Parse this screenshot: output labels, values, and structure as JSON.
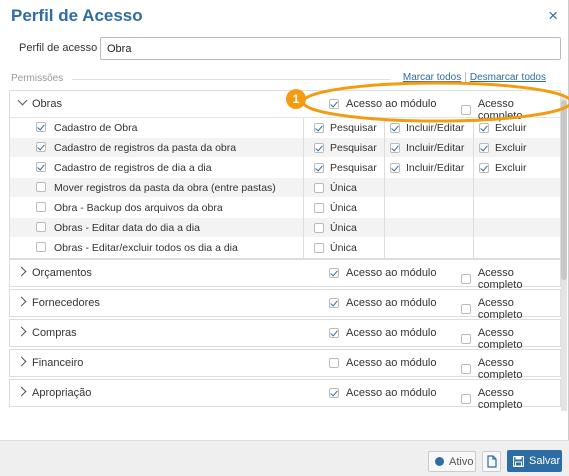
{
  "modal": {
    "title": "Perfil de Acesso",
    "close": "×"
  },
  "form": {
    "label": "Perfil de acesso *",
    "value": "Obra"
  },
  "permissions": {
    "label": "Permissões",
    "mark_all": "Marcar todos",
    "separator": "|",
    "unmark_all": "Desmarcar todos"
  },
  "callout": {
    "number": "1"
  },
  "modules": [
    {
      "name": "Obras",
      "expanded": true,
      "module_access": "Acesso ao módulo",
      "module_checked": true,
      "full_access": "Acesso completo",
      "full_checked": false,
      "items": [
        {
          "label": "Cadastro de Obra",
          "checked": true,
          "opts": [
            {
              "label": "Pesquisar",
              "checked": true
            },
            {
              "label": "Incluir/Editar",
              "checked": true
            },
            {
              "label": "Excluir",
              "checked": true
            }
          ]
        },
        {
          "label": "Cadastro de registros da pasta da obra",
          "checked": true,
          "opts": [
            {
              "label": "Pesquisar",
              "checked": true
            },
            {
              "label": "Incluir/Editar",
              "checked": true
            },
            {
              "label": "Excluir",
              "checked": true
            }
          ]
        },
        {
          "label": "Cadastro de registros de dia a dia",
          "checked": true,
          "opts": [
            {
              "label": "Pesquisar",
              "checked": true
            },
            {
              "label": "Incluir/Editar",
              "checked": true
            },
            {
              "label": "Excluir",
              "checked": true
            }
          ]
        },
        {
          "label": "Mover registros da pasta da obra (entre pastas)",
          "checked": false,
          "opts": [
            {
              "label": "Única",
              "checked": false
            }
          ]
        },
        {
          "label": "Obra - Backup dos arquivos da obra",
          "checked": false,
          "opts": [
            {
              "label": "Única",
              "checked": false
            }
          ]
        },
        {
          "label": "Obras - Editar data do dia a dia",
          "checked": false,
          "opts": [
            {
              "label": "Única",
              "checked": false
            }
          ]
        },
        {
          "label": "Obras - Editar/excluir todos os dia a dia",
          "checked": false,
          "opts": [
            {
              "label": "Única",
              "checked": false
            }
          ]
        }
      ]
    },
    {
      "name": "Orçamentos",
      "expanded": false,
      "module_access": "Acesso ao módulo",
      "module_checked": true,
      "full_access": "Acesso completo",
      "full_checked": false
    },
    {
      "name": "Fornecedores",
      "expanded": false,
      "module_access": "Acesso ao módulo",
      "module_checked": true,
      "full_access": "Acesso completo",
      "full_checked": false
    },
    {
      "name": "Compras",
      "expanded": false,
      "module_access": "Acesso ao módulo",
      "module_checked": true,
      "full_access": "Acesso completo",
      "full_checked": false
    },
    {
      "name": "Financeiro",
      "expanded": false,
      "module_access": "Acesso ao módulo",
      "module_checked": false,
      "full_access": "Acesso completo",
      "full_checked": false
    },
    {
      "name": "Apropriação",
      "expanded": false,
      "module_access": "Acesso ao módulo",
      "module_checked": true,
      "full_access": "Acesso completo",
      "full_checked": false
    }
  ],
  "footer": {
    "ativo": "Ativo",
    "salvar": "Salvar"
  },
  "colors": {
    "accent": "#2d6da3",
    "callout": "#f39c12"
  }
}
